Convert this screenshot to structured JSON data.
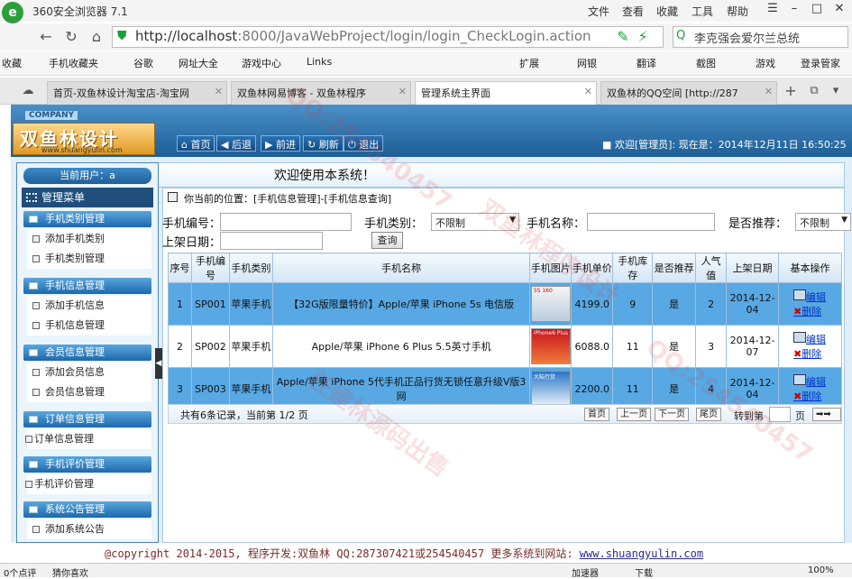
{
  "browser": {
    "app_title": "360安全浏览器 7.1",
    "menu": [
      "文件",
      "查看",
      "收藏",
      "工具",
      "帮助"
    ],
    "url_host": "http://localhost",
    "url_rest": ":8000/JavaWebProject/login/login_CheckLogin.action",
    "search_text": "李克强会爱尔兰总统",
    "bookmarks": [
      "收藏",
      "手机收藏夹",
      "谷歌",
      "网址大全",
      "游戏中心",
      "Links"
    ],
    "right_tools": [
      "扩展",
      "网银",
      "翻译",
      "截图",
      "游戏",
      "登录管家"
    ],
    "tabs": [
      {
        "label": "首页-双鱼林设计淘宝店-淘宝网"
      },
      {
        "label": "双鱼林网易博客 - 双鱼林程序"
      },
      {
        "label": "管理系统主界面"
      },
      {
        "label": "双鱼林的QQ空间 [http://287"
      }
    ],
    "status_left": "0个点评",
    "status_tip": "猜你喜欢",
    "status_right": [
      "加速器",
      "下载",
      "100%"
    ]
  },
  "header": {
    "company_label": "COMPANY",
    "brand": "双鱼林设计",
    "brand_url": "www.shuangyulin.com",
    "buttons": [
      "首页",
      "后退",
      "前进",
      "刷新",
      "退出"
    ],
    "welcome": "欢迎[管理员]:  现在是：2014年12月11日 16:50:25",
    "banner": "欢迎使用本系统！"
  },
  "sidebar": {
    "current_user": "当前用户：a",
    "menu_title": "管理菜单",
    "groups": [
      {
        "title": "手机类别管理",
        "items": [
          "添加手机类别",
          "手机类别管理"
        ]
      },
      {
        "title": "手机信息管理",
        "items": [
          "添加手机信息",
          "手机信息管理"
        ]
      },
      {
        "title": "会员信息管理",
        "items": [
          "添加会员信息",
          "会员信息管理"
        ]
      },
      {
        "title": "订单信息管理",
        "items": [
          "订单信息管理"
        ]
      },
      {
        "title": "手机评价管理",
        "items": [
          "手机评价管理"
        ]
      },
      {
        "title": "系统公告管理",
        "items": [
          "添加系统公告"
        ]
      }
    ]
  },
  "main": {
    "location": "你当前的位置：[手机信息管理]-[手机信息查询]",
    "filters": {
      "phone_no_label": "手机编号：",
      "category_label": "手机类别：",
      "category_value": "不限制",
      "name_label": "手机名称：",
      "recommend_label": "是否推荐：",
      "recommend_value": "不限制",
      "date_label": "上架日期：",
      "query_button": "查询"
    },
    "columns": [
      "序号",
      "手机编号",
      "手机类别",
      "手机名称",
      "手机图片",
      "手机单价",
      "手机库存",
      "是否推荐",
      "人气值",
      "上架日期",
      "基本操作"
    ],
    "rows": [
      {
        "idx": "1",
        "code": "SP001",
        "cat": "苹果手机",
        "name": "【32G版限量特价】Apple/苹果 iPhone 5s 电信版",
        "img_label": "5S 160",
        "price": "4199.0",
        "stock": "9",
        "rec": "是",
        "pop": "2",
        "date": "2014-12-04",
        "edit": "编辑",
        "del": "删除"
      },
      {
        "idx": "2",
        "code": "SP002",
        "cat": "苹果手机",
        "name": "Apple/苹果 iPhone 6 Plus 5.5英寸手机",
        "img_label": "iPhone6 Plus",
        "price": "6088.0",
        "stock": "11",
        "rec": "是",
        "pop": "3",
        "date": "2014-12-07",
        "edit": "编辑",
        "del": "删除"
      },
      {
        "idx": "3",
        "code": "SP003",
        "cat": "苹果手机",
        "name": "Apple/苹果 iPhone 5代手机正品行货无锁任意升级V版3网",
        "img_label": "大陆行货",
        "price": "2200.0",
        "stock": "11",
        "rec": "是",
        "pop": "4",
        "date": "2014-12-04",
        "edit": "编辑",
        "del": "删除"
      }
    ],
    "pager": {
      "summary": "共有6条记录，当前第 1/2 页",
      "buttons": [
        "首页",
        "上一页",
        "下一页",
        "尾页"
      ],
      "goto_label": "转到第",
      "page_suffix": "页"
    }
  },
  "footer": {
    "text": "@copyright 2014-2015, 程序开发:双鱼林  QQ:287307421或254540457  更多系统到网站:",
    "url": "www.shuangyulin.com"
  },
  "watermark": [
    "QQ:254540457",
    "双鱼林程序设计",
    "任建林源码出售"
  ]
}
